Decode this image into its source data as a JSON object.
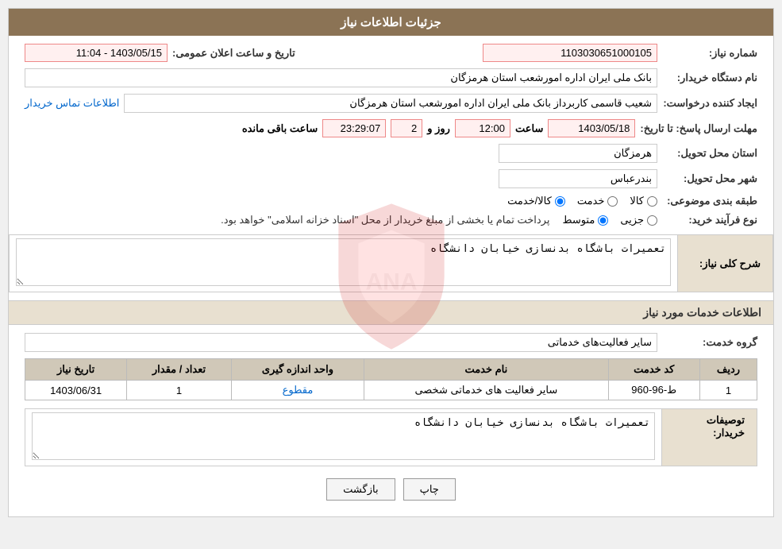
{
  "page": {
    "title": "جزئیات اطلاعات نیاز",
    "header": {
      "title": "جزئیات اطلاعات نیاز"
    },
    "fields": {
      "shomareNiaz_label": "شماره نیاز:",
      "shomareNiaz_value": "1103030651000105",
      "namDastgah_label": "نام دستگاه خریدار:",
      "namDastgah_value": "بانک ملی ایران اداره امورشعب استان هرمزگان",
      "tarikh_label": "تاریخ و ساعت اعلان عمومی:",
      "tarikh_value": "1403/05/15 - 11:04",
      "ijadKonande_label": "ایجاد کننده درخواست:",
      "ijadKonande_value": "شعیب قاسمی کاربرداز بانک ملی ایران اداره امورشعب استان هرمزگان",
      "ettela_link": "اطلاعات تماس خریدار",
      "mohlatErsalPasokh_label": "مهلت ارسال پاسخ: تا تاریخ:",
      "mohlatDate": "1403/05/18",
      "mohlatSaat_label": "ساعت",
      "mohlatSaat_value": "12:00",
      "mohlatRoz_label": "روز و",
      "mohlatRoz_value": "2",
      "mohlatBaghi_label": "ساعت باقی مانده",
      "mohlatBaghi_value": "23:29:07",
      "ostan_label": "استان محل تحویل:",
      "ostan_value": "هرمزگان",
      "shahr_label": "شهر محل تحویل:",
      "shahr_value": "بندرعباس",
      "tabaghe_label": "طبقه بندی موضوعی:",
      "tabaghe_options": [
        "کالا",
        "خدمت",
        "کالا/خدمت"
      ],
      "tabaghe_selected": "کالا/خدمت",
      "noeFarayand_label": "نوع فرآیند خرید:",
      "noeFarayand_options": [
        "جزیی",
        "متوسط"
      ],
      "noeFarayand_selected": "متوسط",
      "noeFarayand_note": "پرداخت تمام یا بخشی از مبلغ خریدار از محل \"اسناد خزانه اسلامی\" خواهد بود.",
      "sharhKolliNiaz_label": "شرح کلی نیاز:",
      "sharhKolliNiaz_value": "تعمیرات باشگاه بدنسازی خیابان دانشگاه",
      "khadamat_header": "اطلاعات خدمات مورد نیاز",
      "gorohKhadamat_label": "گروه خدمت:",
      "gorohKhadamat_value": "سایر فعالیت‌های خدماتی",
      "table": {
        "headers": [
          "ردیف",
          "کد خدمت",
          "نام خدمت",
          "واحد اندازه گیری",
          "تعداد / مقدار",
          "تاریخ نیاز"
        ],
        "rows": [
          {
            "radif": "1",
            "kodKhadamat": "ط-96-960",
            "namKhadamat": "سایر فعالیت های خدماتی شخصی",
            "vahed": "مقطوع",
            "tedad": "1",
            "tarikh": "1403/06/31"
          }
        ]
      },
      "tosaifKhardar_label": "توصیفات خریدار:",
      "tosaifKhardar_value": "تعمیرات باشگاه بدنسازی خیابان دانشگاه"
    },
    "buttons": {
      "print": "چاپ",
      "back": "بازگشت"
    }
  }
}
